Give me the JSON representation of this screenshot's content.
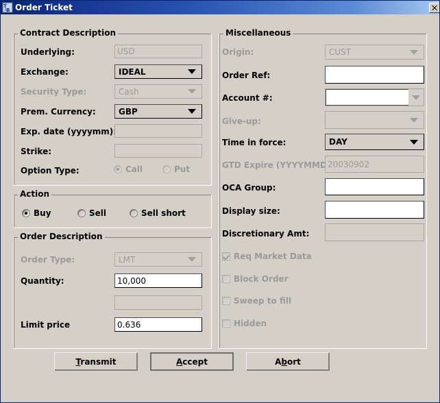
{
  "window": {
    "title": "Order Ticket",
    "icon": "tb-app-icon",
    "close_label": "x",
    "bg_color": "#d4d0c8",
    "titlebar_color": "#0a246a"
  },
  "contract_description": {
    "title": "Contract Description",
    "underlying": {
      "label": "Underlying:",
      "value": "USD",
      "enabled": false,
      "type": "textfield"
    },
    "exchange": {
      "label": "Exchange:",
      "value": "IDEAL",
      "enabled": true,
      "type": "combo"
    },
    "security_type": {
      "label": "Security Type:",
      "value": "Cash",
      "enabled": false,
      "type": "combo"
    },
    "prem_currency": {
      "label": "Prem. Currency:",
      "value": "GBP",
      "enabled": true,
      "type": "combo"
    },
    "exp_date": {
      "label": "Exp. date (yyyymm):",
      "value": "",
      "enabled": false,
      "type": "textfield"
    },
    "strike": {
      "label": "Strike:",
      "value": "",
      "enabled": false,
      "type": "textfield"
    },
    "option_type": {
      "label": "Option Type:",
      "enabled": false,
      "options": [
        {
          "label": "Call",
          "selected": true
        },
        {
          "label": "Put",
          "selected": false
        }
      ]
    }
  },
  "action": {
    "title": "Action",
    "options": [
      {
        "label": "Buy",
        "selected": true
      },
      {
        "label": "Sell",
        "selected": false
      },
      {
        "label": "Sell short",
        "selected": false
      }
    ]
  },
  "order_description": {
    "title": "Order Description",
    "order_type": {
      "label": "Order Type:",
      "value": "LMT",
      "enabled": false,
      "type": "combo"
    },
    "quantity": {
      "label": "Quantity:",
      "value": "10,000",
      "enabled": true,
      "type": "textfield"
    },
    "aux_field": {
      "label": "",
      "value": "",
      "enabled": false,
      "type": "textfield"
    },
    "limit_price": {
      "label": "Limit price",
      "value": "0.636",
      "enabled": true,
      "type": "textfield"
    }
  },
  "miscellaneous": {
    "title": "Miscellaneous",
    "origin": {
      "label": "Origin:",
      "value": "CUST",
      "enabled": false,
      "type": "combo"
    },
    "order_ref": {
      "label": "Order Ref:",
      "value": "",
      "enabled": true,
      "type": "textfield"
    },
    "account": {
      "label": "Account #:",
      "value": "",
      "enabled": true,
      "type": "combo-editable"
    },
    "give_up": {
      "label": "Give-up:",
      "value": "",
      "enabled": false,
      "type": "combo"
    },
    "time_in_force": {
      "label": "Time in force:",
      "value": "DAY",
      "enabled": true,
      "type": "combo"
    },
    "gtd_expire": {
      "label": "GTD Expire (YYYYMMDD):",
      "value": "20030902",
      "enabled": false,
      "type": "textfield"
    },
    "oca_group": {
      "label": "OCA Group:",
      "value": "",
      "enabled": true,
      "type": "textfield"
    },
    "display_size": {
      "label": "Display size:",
      "value": "",
      "enabled": true,
      "type": "textfield"
    },
    "discretionary_amt": {
      "label": "Discretionary Amt:",
      "value": "",
      "enabled": false,
      "type": "textfield"
    },
    "checkboxes": [
      {
        "label": "Req Market Data",
        "checked": true,
        "enabled": false
      },
      {
        "label": "Block Order",
        "checked": false,
        "enabled": false
      },
      {
        "label": "Sweep to fill",
        "checked": false,
        "enabled": false
      },
      {
        "label": "Hidden",
        "checked": false,
        "enabled": false
      }
    ]
  },
  "buttons": {
    "transmit": {
      "label": "Transmit",
      "mnemonic": "T",
      "focused": false
    },
    "accept": {
      "label": "Accept",
      "mnemonic": "A",
      "focused": true
    },
    "abort": {
      "label": "Abort",
      "mnemonic": "b",
      "focused": false
    }
  }
}
